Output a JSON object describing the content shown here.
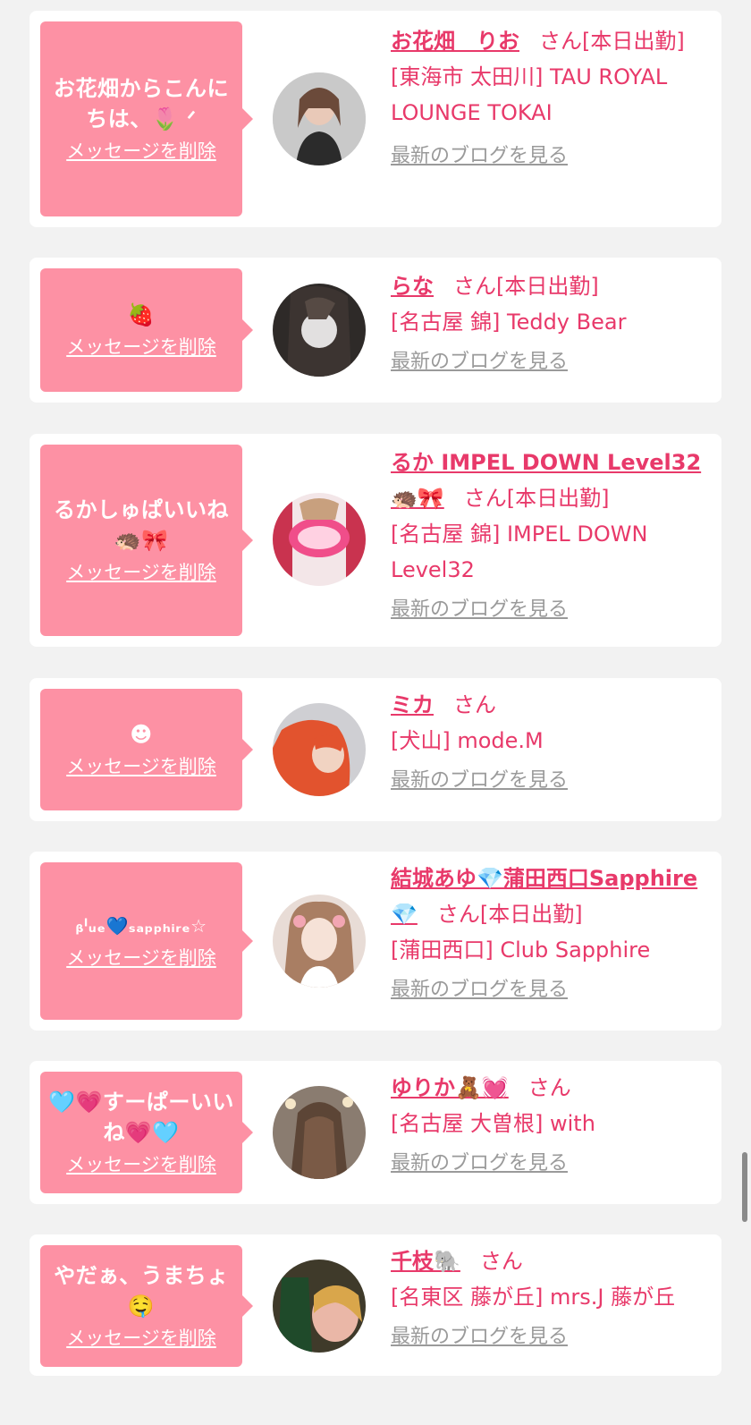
{
  "cards": [
    {
      "message": "お花畑からこんにちは、🌷 ᐟ",
      "delete_label": "メッセージを削除",
      "name": "お花畑　りお",
      "honorific": "さん",
      "status": "[本日出勤]",
      "shop": "[東海市 太田川] TAU ROYAL LOUNGE TOKAI",
      "blog_label": "最新のブログを見る"
    },
    {
      "message": "🍓",
      "delete_label": "メッセージを削除",
      "name": "らな",
      "honorific": "さん",
      "status": "[本日出勤]",
      "shop": "[名古屋 錦] Teddy Bear",
      "blog_label": "最新のブログを見る"
    },
    {
      "message": "るかしゅぱいいね🦔🎀",
      "delete_label": "メッセージを削除",
      "name": "るか IMPEL DOWN Level32 🦔🎀",
      "honorific": "さん",
      "status": "[本日出勤]",
      "shop": "[名古屋 錦] IMPEL DOWN Level32",
      "blog_label": "最新のブログを見る"
    },
    {
      "message": "☻",
      "delete_label": "メッセージを削除",
      "name": "ミカ",
      "honorific": "さん",
      "status": "",
      "shop": "[犬山] mode.M",
      "blog_label": "最新のブログを見る"
    },
    {
      "message": "ᵦˡᵤₑ💙ₛₐₚₚₕᵢᵣₑ☆",
      "delete_label": "メッセージを削除",
      "name": "結城あゆ💎蒲田西口Sapphire💎",
      "honorific": "さん",
      "status": "[本日出勤]",
      "shop": "[蒲田西口] Club Sapphire",
      "blog_label": "最新のブログを見る"
    },
    {
      "message": "🩵💗すーぱーいいね💗🩵",
      "delete_label": "メッセージを削除",
      "name": "ゆりか🧸💓",
      "honorific": "さん",
      "status": "",
      "shop": "[名古屋 大曽根] with",
      "blog_label": "最新のブログを見る"
    },
    {
      "message": "やだぁ、うまちょ🤤",
      "delete_label": "メッセージを削除",
      "name": "千枝🐘",
      "honorific": "さん",
      "status": "",
      "shop": "[名東区 藤が丘] mrs.J 藤が丘",
      "blog_label": "最新のブログを見る"
    }
  ],
  "colors": {
    "accent": "#e8396a",
    "bubble": "#fd91a4",
    "link_gray": "#9a9a9a",
    "background": "#f2f2f2"
  }
}
